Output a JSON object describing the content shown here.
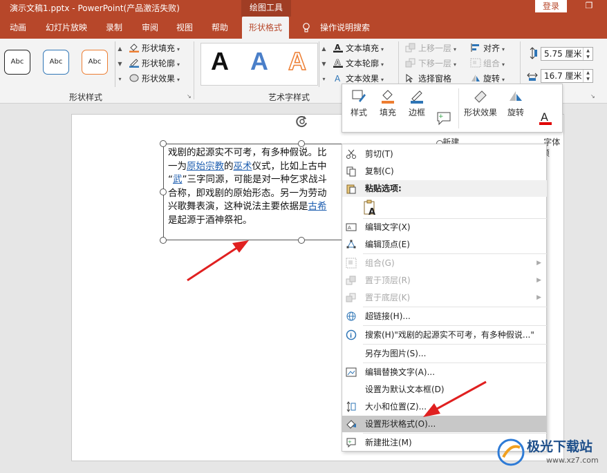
{
  "titlebar": {
    "title": "演示文稿1.pptx  -  PowerPoint(产品激活失败)",
    "context_tab": "绘图工具",
    "login": "登录",
    "restore": "❐"
  },
  "tabs": [
    {
      "label": "动画"
    },
    {
      "label": "幻灯片放映"
    },
    {
      "label": "录制"
    },
    {
      "label": "审阅"
    },
    {
      "label": "视图"
    },
    {
      "label": "帮助"
    },
    {
      "label": "形状格式"
    },
    {
      "label": "操作说明搜索"
    }
  ],
  "ribbon": {
    "shape_style_samples": [
      "Abc",
      "Abc",
      "Abc"
    ],
    "shape_fill": "形状填充",
    "shape_outline": "形状轮廓",
    "shape_effects": "形状效果",
    "shape_styles_label": "形状样式",
    "wordart_letter": "A",
    "text_fill": "文本填充",
    "text_outline": "文本轮廓",
    "text_effects": "文本效果",
    "wordart_label": "艺术字样式",
    "bring_forward": "上移一层",
    "send_backward": "下移一层",
    "selection_pane": "选择窗格",
    "align": "对齐",
    "group": "组合",
    "rotate": "旋转",
    "height": "5.75 厘米",
    "width": "16.7 厘米",
    "colors": {
      "accent": "#b7472a",
      "outline_blue": "#2e75b6",
      "outline_orange": "#ed7d31"
    }
  },
  "textbox": {
    "line1": "戏剧的起源实不可考，有多种假说。比",
    "line2a": "一为",
    "line2link1": "原始宗教",
    "line2b": "的",
    "line2link2": "巫术",
    "line2c": "仪式，比如上古中",
    "line3a": "“",
    "line3link": "武",
    "line3b": "”三字同源，可能是对一种乞求战斗",
    "line4": "合称，即戏剧的原始形态。另一为劳动",
    "line5a": "兴歌舞表演，这种说法主要依据是",
    "line5link": "古希",
    "line6": "是起源于酒神祭祀。"
  },
  "minibar": {
    "items": [
      {
        "label": "样式",
        "icon": "style-icon"
      },
      {
        "label": "填充",
        "icon": "fill-bucket-icon"
      },
      {
        "label": "边框",
        "icon": "outline-pen-icon"
      },
      {
        "label": "新建\n批注",
        "icon": "new-comment-icon"
      },
      {
        "label": "形状效果",
        "icon": "shape-effects-icon"
      },
      {
        "label": "旋转",
        "icon": "rotate-icon"
      },
      {
        "label": "字体\n颜",
        "icon": "font-color-icon"
      }
    ]
  },
  "context_menu": {
    "cut": "剪切(T)",
    "copy": "复制(C)",
    "paste_options": "粘贴选项:",
    "edit_text": "编辑文字(X)",
    "edit_points": "编辑顶点(E)",
    "group": "组合(G)",
    "bring_to_front": "置于顶层(R)",
    "send_to_back": "置于底层(K)",
    "hyperlink": "超链接(H)...",
    "search": "搜索(H)\"戏剧的起源实不可考，有多种假说...\"",
    "save_as_picture": "另存为图片(S)...",
    "edit_alt_text": "编辑替换文字(A)...",
    "set_default_textbox": "设置为默认文本框(D)",
    "size_position": "大小和位置(Z)...",
    "format_shape": "设置形状格式(O)...",
    "new_comment": "新建批注(M)"
  },
  "watermark": {
    "text": "极光下载站",
    "url": "www.xz7.com"
  }
}
